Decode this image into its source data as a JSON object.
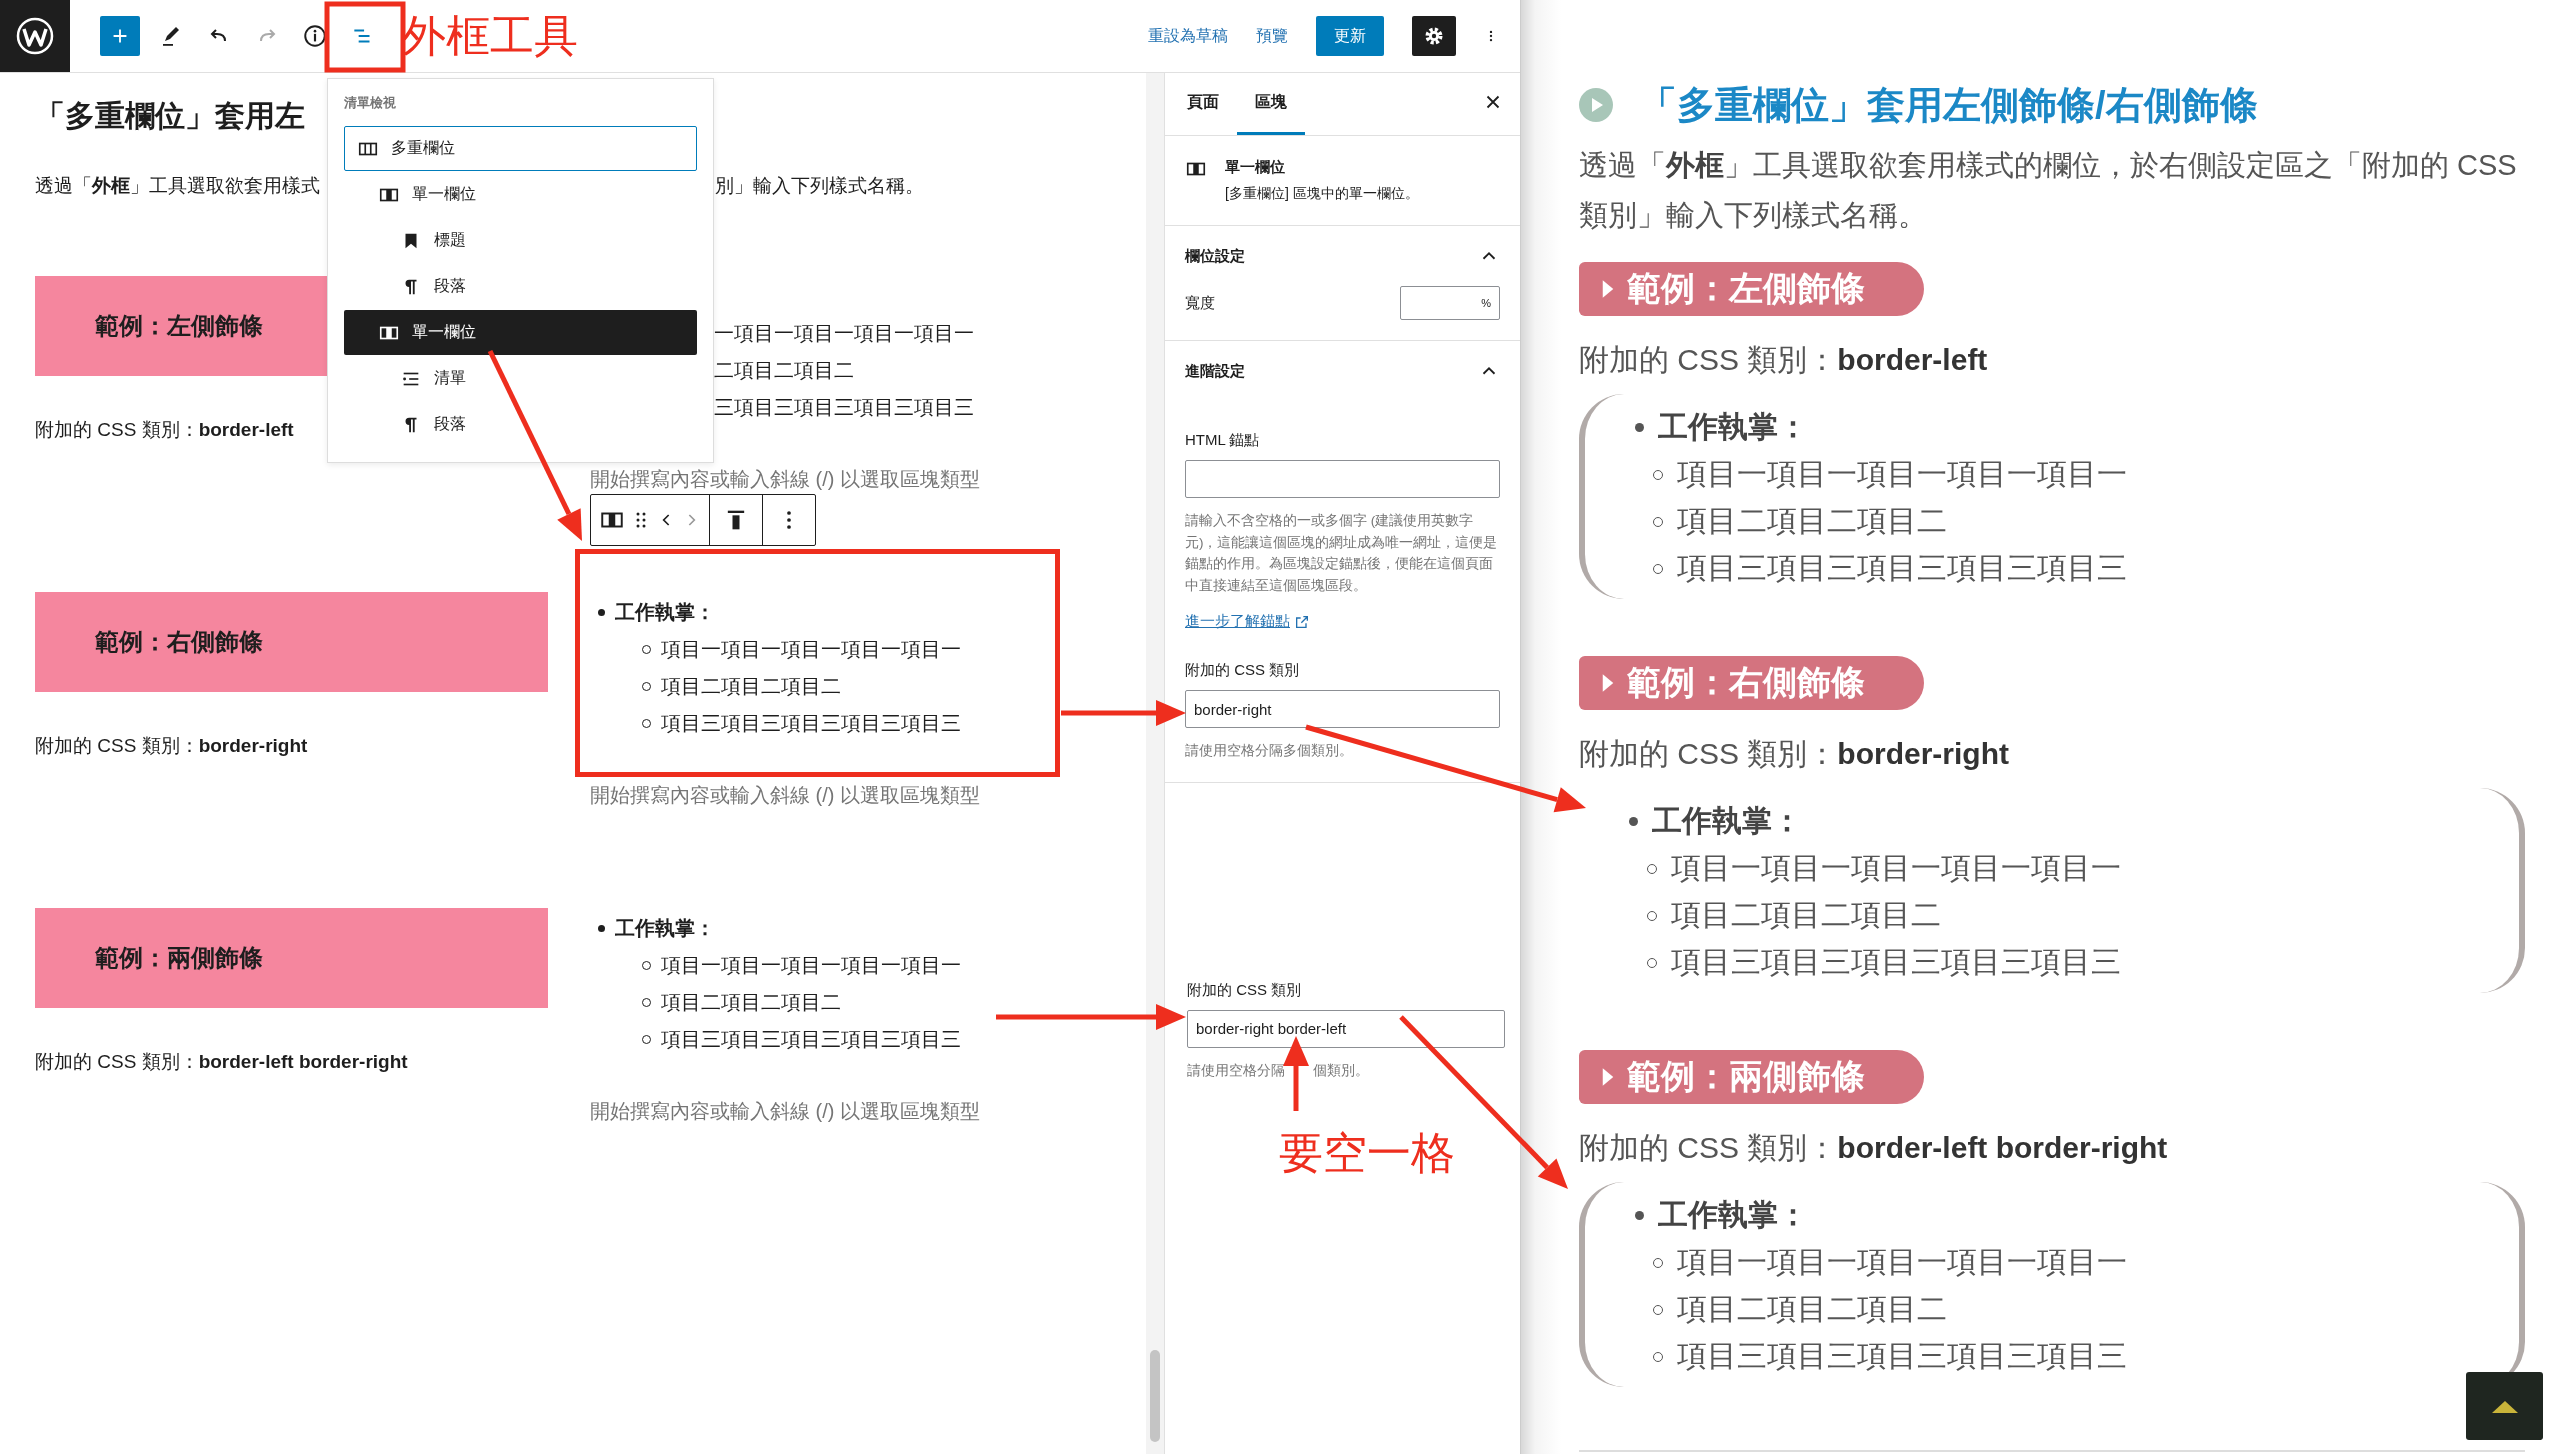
{
  "toolbar": {
    "annotation": "外框工具",
    "actions": [
      {
        "label": "重設為草稿",
        "kind": "link"
      },
      {
        "label": "預覽",
        "kind": "link"
      },
      {
        "label": "更新",
        "kind": "primary"
      }
    ]
  },
  "list_view": {
    "title": "清單檢視",
    "items": [
      {
        "label": "多重欄位",
        "kind": "columns",
        "selected": false,
        "focused": true,
        "children": [
          {
            "label": "單一欄位",
            "kind": "column",
            "selected": false,
            "focused": false,
            "children": [
              {
                "label": "標題",
                "kind": "heading",
                "selected": false,
                "focused": false
              },
              {
                "label": "段落",
                "kind": "paragraph",
                "selected": false,
                "focused": false
              }
            ]
          },
          {
            "label": "單一欄位",
            "kind": "column",
            "selected": true,
            "focused": false,
            "children": [
              {
                "label": "清單",
                "kind": "list",
                "selected": false,
                "focused": false
              },
              {
                "label": "段落",
                "kind": "paragraph",
                "selected": false,
                "focused": false
              }
            ]
          }
        ]
      }
    ]
  },
  "editor": {
    "title": "「多重欄位」套用左",
    "intro": [
      "透過「**外框**」工具選取欲套用樣式",
      "別」輸入下列樣式名稱。"
    ],
    "examples": [
      {
        "heading": "範例：左側飾條",
        "css_label": "附加的 CSS 類別：**border-left**",
        "highlighted": false,
        "list": {
          "items": [
            "一項目一項目一項目一項目一",
            "二項目二項目二",
            "三項目三項目三項目三項目三"
          ]
        },
        "placeholder": "開始撰寫內容或輸入斜線 (/) 以選取區塊類型"
      },
      {
        "heading": "範例：右側飾條",
        "css_label": "附加的 CSS 類別：**border-right**",
        "highlighted": true,
        "list": {
          "title": "工作執掌：",
          "items": [
            "項目一項目一項目一項目一項目一",
            "項目二項目二項目二",
            "項目三項目三項目三項目三項目三"
          ]
        },
        "placeholder": "開始撰寫內容或輸入斜線 (/) 以選取區塊類型"
      },
      {
        "heading": "範例：兩側飾條",
        "css_label": "附加的 CSS 類別：**border-left border-right**",
        "highlighted": false,
        "list": {
          "title": "工作執掌：",
          "items": [
            "項目一項目一項目一項目一項目一",
            "項目二項目二項目二",
            "項目三項目三項目三項目三項目三"
          ]
        },
        "placeholder": "開始撰寫內容或輸入斜線 (/) 以選取區塊類型"
      }
    ]
  },
  "sidebar": {
    "tabs": [
      {
        "label": "頁面",
        "selected": false
      },
      {
        "label": "區塊",
        "selected": true
      }
    ],
    "block": {
      "name": "單一欄位",
      "description": "[多重欄位] 區塊中的單一欄位。"
    },
    "panels": [
      {
        "title": "欄位設定",
        "expanded": true,
        "fields": [
          {
            "kind": "width",
            "label": "寬度",
            "unit": "%"
          }
        ]
      },
      {
        "title": "進階設定",
        "expanded": true,
        "fields": [
          {
            "kind": "text",
            "label": "HTML 錨點",
            "help": "請輸入不含空格的一或多個字 (建議使用英數字元)，這能讓這個區塊的網址成為唯一網址，這便是錨點的作用。為區塊設定錨點後，便能在這個頁面中直接連結至這個區塊區段。",
            "link": "進一步了解錨點"
          },
          {
            "kind": "text",
            "label": "附加的 CSS 類別",
            "value": "border-right",
            "help": "請使用空格分隔多個類別。"
          }
        ]
      }
    ],
    "pasted_field": {
      "label": "附加的 CSS 類別",
      "value": "border-right border-left",
      "help": [
        "請使用空格分隔",
        "個類別。"
      ],
      "annotation": "要空一格"
    }
  },
  "article": {
    "title": "「多重欄位」套用左側飾條/右側飾條",
    "intro": "透過「**外框**」工具選取欲套用樣式的欄位，於右側設定區之「附加的 CSS 類別」輸入下列樣式名稱。",
    "examples": [
      {
        "heading": "範例：左側飾條",
        "css_label": "附加的 CSS 類別：**border-left**",
        "border_left": true,
        "border_right": false,
        "list": {
          "title": "工作執掌：",
          "items": [
            "項目一項目一項目一項目一項目一",
            "項目二項目二項目二",
            "項目三項目三項目三項目三項目三"
          ]
        }
      },
      {
        "heading": "範例：右側飾條",
        "css_label": "附加的 CSS 類別：**border-right**",
        "border_left": false,
        "border_right": true,
        "list": {
          "title": "工作執掌：",
          "items": [
            "項目一項目一項目一項目一項目一",
            "項目二項目二項目二",
            "項目三項目三項目三項目三項目三"
          ]
        }
      },
      {
        "heading": "範例：兩側飾條",
        "css_label": "附加的 CSS 類別：**border-left border-right**",
        "border_left": true,
        "border_right": true,
        "list": {
          "title": "工作執掌：",
          "items": [
            "項目一項目一項目一項目一項目一",
            "項目二項目二項目二",
            "項目三項目三項目三項目三項目三"
          ]
        }
      }
    ]
  }
}
